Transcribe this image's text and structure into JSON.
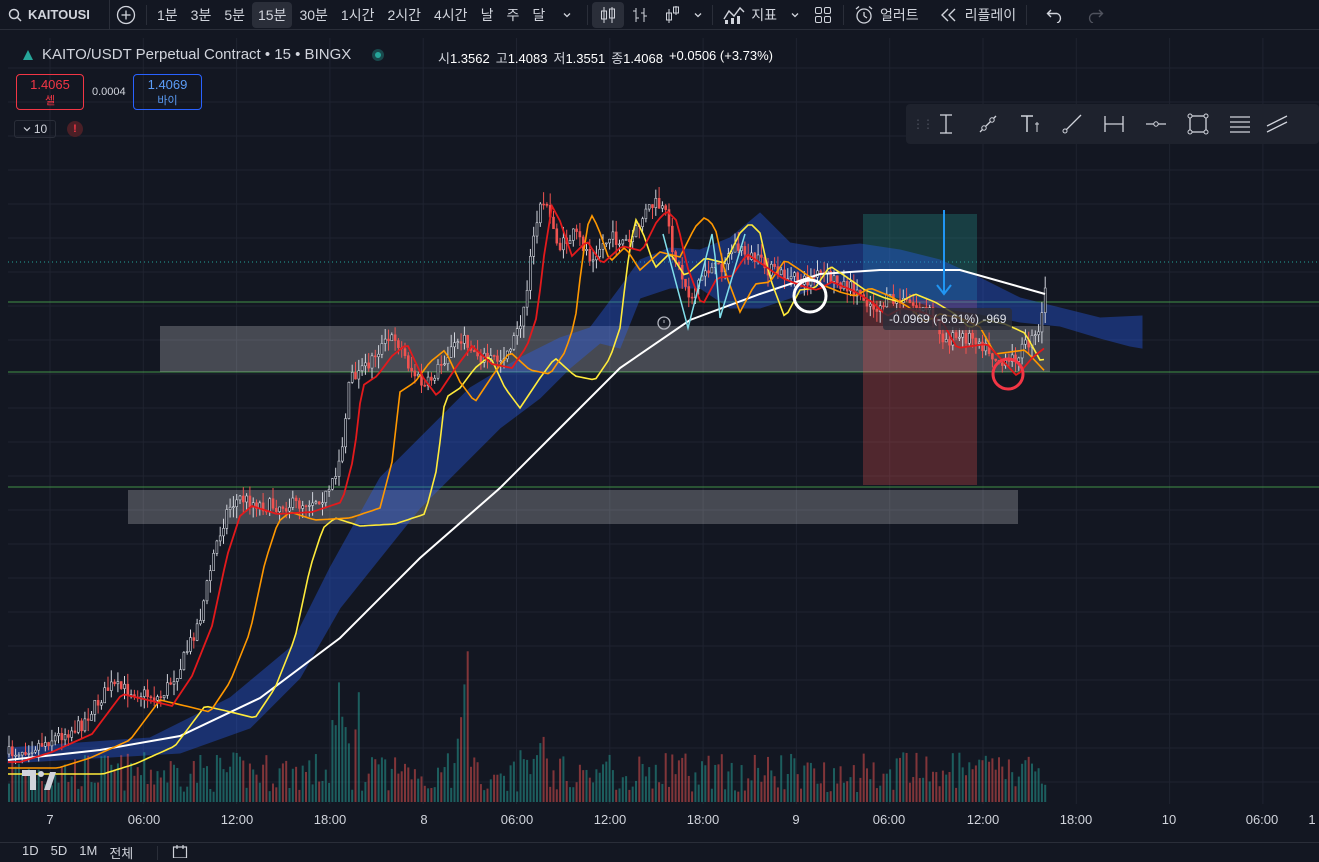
{
  "toolbar": {
    "symbol": "KAITOUSI",
    "intervals": [
      "1분",
      "3분",
      "5분",
      "15분",
      "30분",
      "1시간",
      "2시간",
      "4시간",
      "날",
      "주",
      "달"
    ],
    "active_interval": "15분",
    "indicators_label": "지표",
    "alert_label": "얼러트",
    "replay_label": "리플레이"
  },
  "legend": {
    "title": "KAITO/USDT Perpetual Contract • 15 • BINGX",
    "open_label": "시",
    "open": "1.3562",
    "high_label": "고",
    "high": "1.4083",
    "low_label": "저",
    "low": "1.3551",
    "close_label": "종",
    "close": "1.4068",
    "change": "+0.0506 (+3.73%)"
  },
  "trade": {
    "sell_price": "1.4065",
    "sell_label": "셀",
    "buy_price": "1.4069",
    "buy_label": "바이",
    "spread": "0.0004",
    "quantity": "10",
    "warning": "!"
  },
  "position": {
    "pnl_text": "-0.0969 (-6.61%) -969"
  },
  "time_axis": [
    "7",
    "06:00",
    "12:00",
    "18:00",
    "8",
    "06:00",
    "12:00",
    "18:00",
    "9",
    "06:00",
    "12:00",
    "18:00",
    "10",
    "06:00",
    "1"
  ],
  "ranges": [
    "1D",
    "5D",
    "1M",
    "전체"
  ],
  "colors": {
    "bg": "#131722",
    "up": "#26a69a",
    "down": "#ef5350",
    "ema_red": "#e31a1c",
    "ema_orange": "#ff9800",
    "ema_yellow": "#ffeb3b",
    "sma_white": "#ffffff",
    "cloud": "#2962ff"
  },
  "icons": {
    "symbol_search": "search-icon",
    "compare": "plus-circle-icon",
    "chart_type": "candles-icon",
    "indicators": "indicators-icon",
    "layouts": "grid-icon",
    "alert": "alarm-clock-icon",
    "replay": "rewind-icon",
    "undo": "undo-icon",
    "redo": "redo-icon"
  }
}
